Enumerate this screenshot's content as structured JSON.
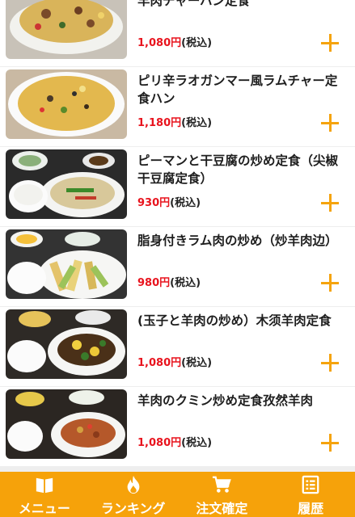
{
  "menu_items": [
    {
      "name": "羊肉チャーハン定食",
      "price": "1,080円",
      "tax": "(税込)"
    },
    {
      "name": "ピリ辛ラオガンマー風ラムチャー定食ハン",
      "price": "1,180円",
      "tax": "(税込)"
    },
    {
      "name": "ピーマンと干豆腐の炒め定食（尖椒干豆腐定食）",
      "price": "930円",
      "tax": "(税込)"
    },
    {
      "name": "脂身付きラム肉の炒め（炒羊肉边）",
      "price": "980円",
      "tax": "(税込)"
    },
    {
      "name": "(玉子と羊肉の炒め）木须羊肉定食",
      "price": "1,080円",
      "tax": "(税込)"
    },
    {
      "name": "羊肉のクミン炒め定食孜然羊肉",
      "price": "1,080円",
      "tax": "(税込)"
    }
  ],
  "tabbar": {
    "tabs": [
      {
        "label": "メニュー",
        "icon": "book-icon"
      },
      {
        "label": "ランキング",
        "icon": "flame-icon"
      },
      {
        "label": "注文確定",
        "icon": "cart-icon"
      },
      {
        "label": "履歴",
        "icon": "history-list-icon"
      }
    ]
  },
  "colors": {
    "accent": "#f6a20a",
    "price": "#e8141e",
    "add_icon": "#f5a30d"
  }
}
